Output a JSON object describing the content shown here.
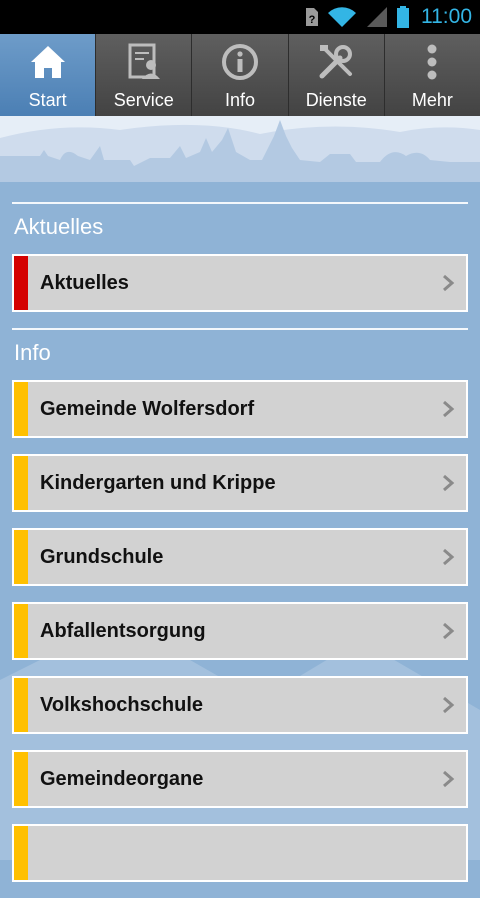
{
  "status_bar": {
    "time": "11:00"
  },
  "tabs": [
    {
      "label": "Start",
      "icon": "home-icon",
      "active": true
    },
    {
      "label": "Service",
      "icon": "document-user-icon",
      "active": false
    },
    {
      "label": "Info",
      "icon": "info-icon",
      "active": false
    },
    {
      "label": "Dienste",
      "icon": "tools-icon",
      "active": false
    },
    {
      "label": "Mehr",
      "icon": "more-vertical-icon",
      "active": false
    }
  ],
  "sections": [
    {
      "title": "Aktuelles",
      "accent": "#d40000",
      "items": [
        "Aktuelles"
      ]
    },
    {
      "title": "Info",
      "accent": "#ffc000",
      "items": [
        "Gemeinde Wolfersdorf",
        "Kindergarten und Krippe",
        "Grundschule",
        "Abfallentsorgung",
        "Volkshochschule",
        "Gemeindeorgane"
      ]
    }
  ],
  "colors": {
    "active_tab": "#5b8cc0",
    "tab_bar": "#525252",
    "background": "#8fb3d6",
    "item_bg": "#d2d2d2"
  }
}
